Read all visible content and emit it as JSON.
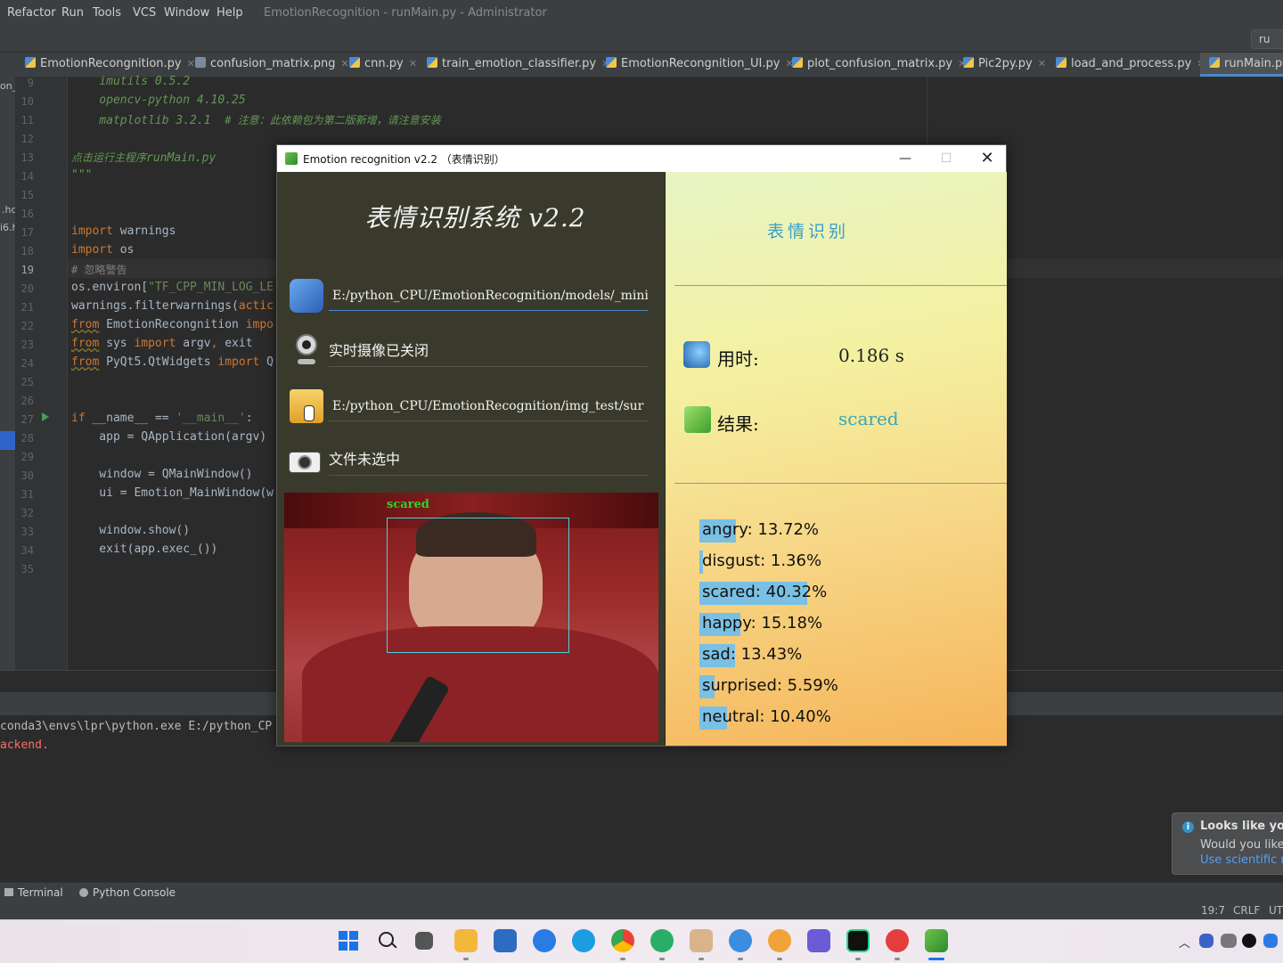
{
  "menu": {
    "items": [
      "Refactor",
      "Run",
      "Tools",
      "VCS",
      "Window",
      "Help"
    ],
    "title": "EmotionRecognition - runMain.py - Administrator"
  },
  "run_config": "ru",
  "tabs": [
    {
      "label": "EmotionRecongnition.py"
    },
    {
      "label": "confusion_matrix.png"
    },
    {
      "label": "cnn.py"
    },
    {
      "label": "train_emotion_classifier.py"
    },
    {
      "label": "EmotionRecongnition_UI.py"
    },
    {
      "label": "plot_confusion_matrix.py"
    },
    {
      "label": "Pic2py.py"
    },
    {
      "label": "load_and_process.py"
    },
    {
      "label": "runMain.py"
    }
  ],
  "strip_labels": [
    "on_",
    ".hc",
    "i6.h"
  ],
  "code": {
    "line_numbers": [
      "9",
      "10",
      "11",
      "12",
      "13",
      "14",
      "15",
      "16",
      "17",
      "18",
      "19",
      "20",
      "21",
      "22",
      "23",
      "24",
      "25",
      "26",
      "27",
      "28",
      "29",
      "30",
      "31",
      "32",
      "33",
      "34",
      "35"
    ],
    "l9": "    imutils 0.5.2",
    "l10": "    opencv-python 4.10.25",
    "l11a": "    matplotlib 3.2.1  ",
    "l11b": "# 注意：此依赖包为第二版新增，请注意安装",
    "l13a": "点击运行主程序",
    "l13b": "runMain.py",
    "l14": "\"\"\"",
    "l17a": "import",
    "l17b": " warnings",
    "l18a": "import",
    "l18b": " os",
    "l19": "# 忽略警告",
    "l20a": "os.environ[",
    "l20b": "\"TF_CPP_MIN_LOG_LE",
    "l21a": "warnings.filterwarnings(",
    "l21b": "actic",
    "l22a": "from",
    "l22b": " EmotionRecongnition ",
    "l22c": "impo",
    "l23a": "from",
    "l23b": " sys ",
    "l23c": "import",
    "l23d": " argv",
    "l23e": ",",
    "l23f": " exit",
    "l24a": "from",
    "l24b": " PyQt5.QtWidgets ",
    "l24c": "import",
    "l24d": " Q",
    "l27a": "if",
    "l27b": " __name__ == ",
    "l27c": "'__main__'",
    "l27d": ":",
    "l28": "    app = QApplication(argv)",
    "l30": "    window = QMainWindow()",
    "l31": "    ui = Emotion_MainWindow(w",
    "l33": "    window.show()",
    "l34": "    exit(app.exec_())"
  },
  "console": {
    "line1": "conda3\\envs\\lpr\\python.exe E:/python_CP",
    "line2": "ackend."
  },
  "tooltabs": {
    "terminal": "Terminal",
    "python_console": "Python Console"
  },
  "status": {
    "position": "19:7",
    "line_sep": "CRLF",
    "encoding": "UT"
  },
  "notification": {
    "title": "Looks like you'",
    "body": "Would you like t",
    "link": "Use scientific mo"
  },
  "app": {
    "window_title": "Emotion recognition v2.2 （表情识别）",
    "heading": "表情识别系统  v2.2",
    "model_path": "E:/python_CPU/EmotionRecognition/models/_mini_",
    "camera_status": "实时摄像已关闭",
    "image_path": "E:/python_CPU/EmotionRecognition/img_test/sur",
    "file_status": "文件未选中",
    "face_label": "scared",
    "section_title": "表情识别",
    "time_label": "用时:",
    "time_value": "0.186 s",
    "result_label": "结果:",
    "result_value": "scared",
    "probabilities": [
      {
        "text": "angry: 13.72%",
        "value": 13.72
      },
      {
        "text": "disgust: 1.36%",
        "value": 1.36
      },
      {
        "text": "scared: 40.32%",
        "value": 40.32
      },
      {
        "text": "happy: 15.18%",
        "value": 15.18
      },
      {
        "text": "sad: 13.43%",
        "value": 13.43
      },
      {
        "text": "surprised: 5.59%",
        "value": 5.59
      },
      {
        "text": "neutral: 10.40%",
        "value": 10.4
      }
    ]
  },
  "colors": {
    "accent": "#4a88c7",
    "bar": "#7ac0e4",
    "result": "#3aa6b8",
    "keyword": "#cc7832"
  }
}
